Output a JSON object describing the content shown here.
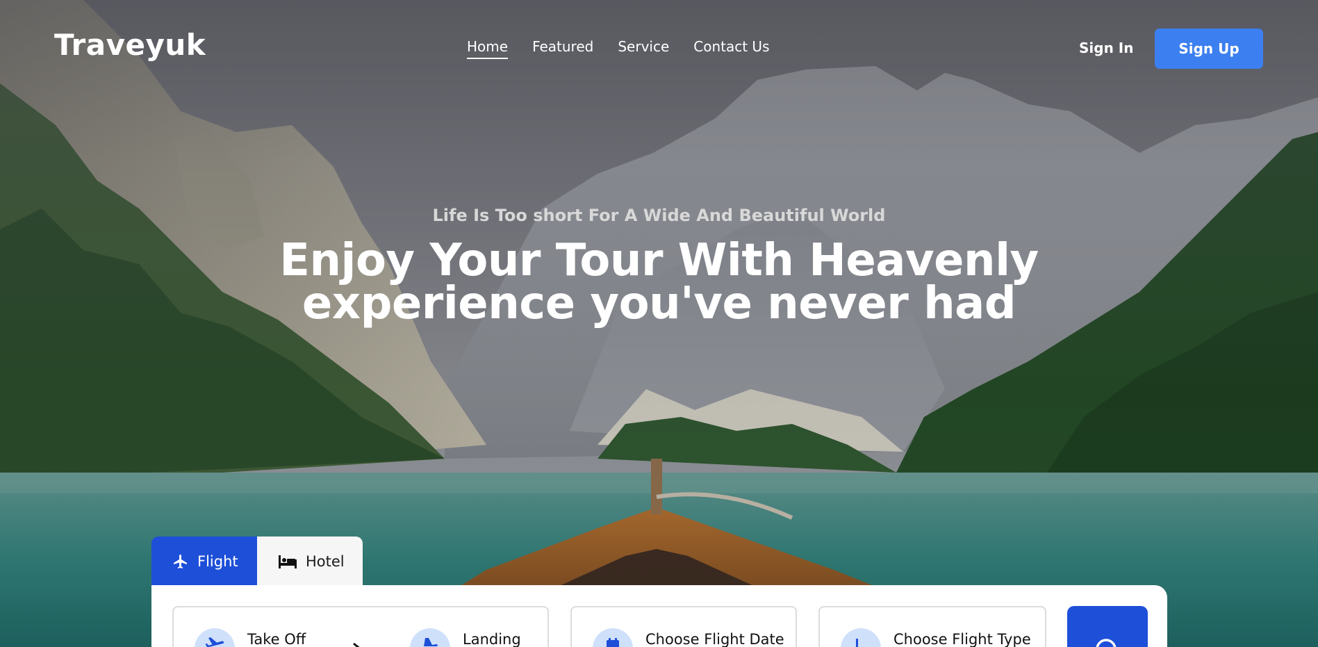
{
  "brand": {
    "logo": "Traveyuk"
  },
  "nav": {
    "items": [
      {
        "label": "Home",
        "active": true
      },
      {
        "label": "Featured",
        "active": false
      },
      {
        "label": "Service",
        "active": false
      },
      {
        "label": "Contact Us",
        "active": false
      }
    ],
    "sign_in": "Sign In",
    "sign_up": "Sign Up"
  },
  "hero": {
    "tagline": "Life Is Too short For A Wide And Beautiful World",
    "headline_line1": "Enjoy Your Tour With Heavenly",
    "headline_line2": "experience you've never had"
  },
  "booking": {
    "tabs": [
      {
        "label": "Flight",
        "icon": "airplane-icon",
        "selected": true
      },
      {
        "label": "Hotel",
        "icon": "bed-icon",
        "selected": false
      }
    ],
    "fields": {
      "take_off": "Take Off",
      "landing": "Landing",
      "date": "Choose Flight Date",
      "type": "Choose Flight Type"
    }
  },
  "colors": {
    "accent": "#1e4fd8",
    "signup": "#3c7ff0",
    "icon_bg": "#cfe0fb"
  }
}
